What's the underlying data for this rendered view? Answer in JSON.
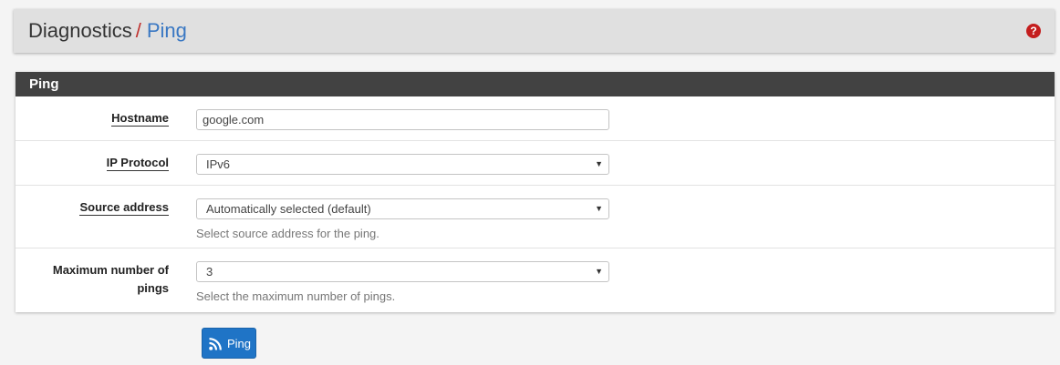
{
  "breadcrumb": {
    "root": "Diagnostics",
    "separator": "/",
    "current": "Ping"
  },
  "help_icon": "question-icon",
  "panel": {
    "title": "Ping",
    "fields": {
      "hostname": {
        "label": "Hostname",
        "value": "google.com"
      },
      "ip_protocol": {
        "label": "IP Protocol",
        "value": "IPv6"
      },
      "source_address": {
        "label": "Source address",
        "value": "Automatically selected (default)",
        "help": "Select source address for the ping."
      },
      "max_pings": {
        "label": "Maximum number of pings",
        "value": "3",
        "help": "Select the maximum number of pings."
      }
    }
  },
  "actions": {
    "ping_label": "Ping",
    "ping_icon": "rss-icon"
  },
  "colors": {
    "accent": "#3a78c3",
    "separator": "#c0312e",
    "panel_header": "#424242",
    "button": "#1f74c6"
  }
}
